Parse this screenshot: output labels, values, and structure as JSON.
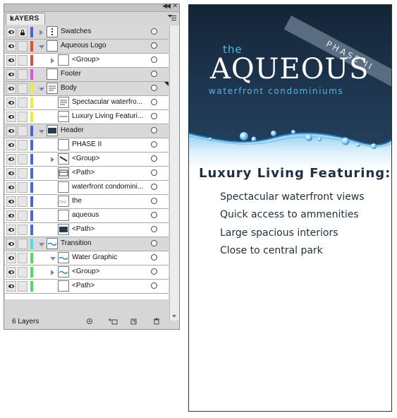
{
  "panel": {
    "tab_label": "LAYERS",
    "footer_count": "6 Layers",
    "rows": [
      {
        "name": "Swatches",
        "kind": "layer",
        "color": "#4b63e6",
        "locked": true,
        "toggle": "closed",
        "thumb": "swatches"
      },
      {
        "name": "Aqueous Logo",
        "kind": "layer",
        "color": "#e84a3a",
        "locked": false,
        "toggle": "open",
        "thumb": "blank"
      },
      {
        "name": "<Group>",
        "kind": "sub",
        "color": "#e84a3a",
        "locked": false,
        "toggle": "closed",
        "thumb": "blank"
      },
      {
        "name": "Footer",
        "kind": "layer",
        "color": "#e44de0",
        "locked": false,
        "toggle": "none",
        "thumb": "blank"
      },
      {
        "name": "Body",
        "kind": "layer",
        "color": "#f2ea3a",
        "locked": false,
        "toggle": "open",
        "thumb": "text"
      },
      {
        "name": "Spectacular waterfro...",
        "kind": "sub",
        "color": "#f2ea3a",
        "locked": false,
        "toggle": "none",
        "thumb": "text"
      },
      {
        "name": "Luxury Living Featuri...",
        "kind": "sub",
        "color": "#f2ea3a",
        "locked": false,
        "toggle": "none",
        "thumb": "line"
      },
      {
        "name": "Header",
        "kind": "layer",
        "color": "#4b63e6",
        "locked": false,
        "toggle": "open",
        "thumb": "dark"
      },
      {
        "name": "PHASE II",
        "kind": "sub",
        "color": "#4b63e6",
        "locked": false,
        "toggle": "none",
        "thumb": "blank"
      },
      {
        "name": "<Group>",
        "kind": "sub",
        "color": "#4b63e6",
        "locked": false,
        "toggle": "closed",
        "thumb": "slash"
      },
      {
        "name": "<Path>",
        "kind": "sub",
        "color": "#4b63e6",
        "locked": false,
        "toggle": "none",
        "thumb": "frame"
      },
      {
        "name": "waterfront condomini...",
        "kind": "sub",
        "color": "#4b63e6",
        "locked": false,
        "toggle": "none",
        "thumb": "blank"
      },
      {
        "name": "the",
        "kind": "sub",
        "color": "#4b63e6",
        "locked": false,
        "toggle": "none",
        "thumb": "the"
      },
      {
        "name": "aqueous",
        "kind": "sub",
        "color": "#4b63e6",
        "locked": false,
        "toggle": "none",
        "thumb": "blank"
      },
      {
        "name": "<Path>",
        "kind": "sub",
        "color": "#4b63e6",
        "locked": false,
        "toggle": "none",
        "thumb": "dark"
      },
      {
        "name": "Transition",
        "kind": "layer",
        "color": "#45e0ea",
        "locked": false,
        "toggle": "open",
        "thumb": "wave"
      },
      {
        "name": "Water Graphic",
        "kind": "sub",
        "color": "#4ce05a",
        "locked": false,
        "toggle": "open",
        "thumb": "wave"
      },
      {
        "name": "<Group>",
        "kind": "sub",
        "color": "#4ce05a",
        "locked": false,
        "toggle": "closed",
        "thumb": "wave"
      },
      {
        "name": "<Path>",
        "kind": "sub",
        "color": "#4ce05a",
        "locked": false,
        "toggle": "none",
        "thumb": "blank"
      }
    ]
  },
  "flyer": {
    "phase": "PHASE II",
    "logo_the": "the",
    "logo_main": "AQUEOUS",
    "logo_sub": "waterfront condominiums",
    "heading": "Luxury Living Featuring:",
    "features": [
      "Spectacular waterfront views",
      "Quick access to ammenities",
      "Large spacious interiors",
      "Close to central park"
    ]
  }
}
